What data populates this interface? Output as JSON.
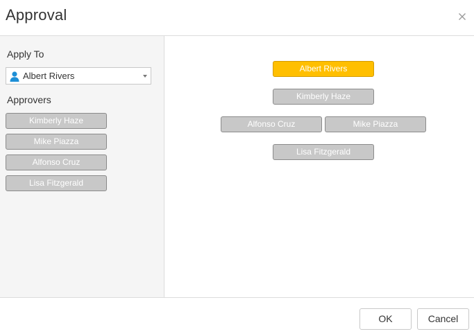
{
  "dialog": {
    "title": "Approval"
  },
  "left_panel": {
    "apply_to_label": "Apply To",
    "apply_to_value": "Albert Rivers",
    "approvers_label": "Approvers",
    "approvers": [
      "Kimberly Haze",
      "Mike Piazza",
      "Alfonso Cruz",
      "Lisa Fitzgerald"
    ]
  },
  "diagram": {
    "root": "Albert Rivers",
    "level1": "Kimberly Haze",
    "level2_left": "Alfonso Cruz",
    "level2_right": "Mike Piazza",
    "level3": "Lisa Fitzgerald"
  },
  "footer": {
    "ok_label": "OK",
    "cancel_label": "Cancel"
  },
  "colors": {
    "active_node": "#ffbf00",
    "inactive_node": "#c8c8c8",
    "user_icon": "#1e8fd6"
  }
}
